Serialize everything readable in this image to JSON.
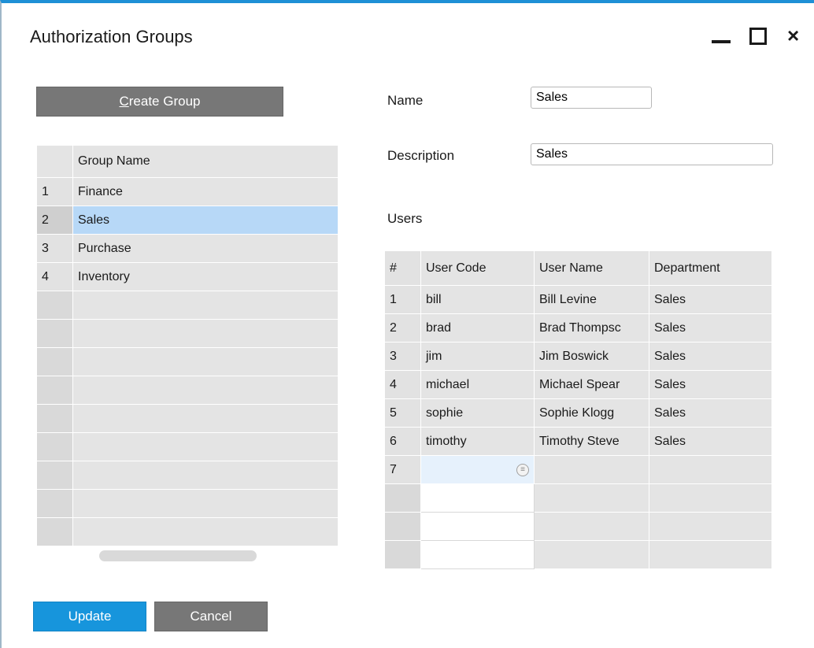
{
  "window": {
    "title": "Authorization Groups",
    "controls": {
      "minimize": "minimize",
      "maximize": "maximize",
      "close": "×"
    }
  },
  "create_group": {
    "mnemonic": "C",
    "rest": "reate Group"
  },
  "groups": {
    "header": "Group Name",
    "rows": [
      {
        "num": "1",
        "name": "Finance"
      },
      {
        "num": "2",
        "name": "Sales"
      },
      {
        "num": "3",
        "name": "Purchase"
      },
      {
        "num": "4",
        "name": "Inventory"
      }
    ],
    "selected_index": 1
  },
  "form": {
    "name_label": "Name",
    "name_value": "Sales",
    "description_label": "Description",
    "description_value": "Sales",
    "users_label": "Users"
  },
  "users": {
    "headers": {
      "num": "#",
      "code": "User Code",
      "name": "User Name",
      "dept": "Department"
    },
    "rows": [
      {
        "num": "1",
        "code": "bill",
        "name": "Bill Levine",
        "dept": "Sales"
      },
      {
        "num": "2",
        "code": "brad",
        "name": "Brad Thompsc",
        "dept": "Sales"
      },
      {
        "num": "3",
        "code": "jim",
        "name": "Jim Boswick",
        "dept": "Sales"
      },
      {
        "num": "4",
        "code": "michael",
        "name": "Michael Spear",
        "dept": "Sales"
      },
      {
        "num": "5",
        "code": "sophie",
        "name": "Sophie Klogg",
        "dept": "Sales"
      },
      {
        "num": "6",
        "code": "timothy",
        "name": "Timothy Steve",
        "dept": "Sales"
      }
    ],
    "new_row_num": "7"
  },
  "buttons": {
    "update": "Update",
    "cancel": "Cancel"
  },
  "colors": {
    "accent": "#1795dc",
    "selected_row": "#b7d8f7",
    "button_gray": "#777777"
  }
}
